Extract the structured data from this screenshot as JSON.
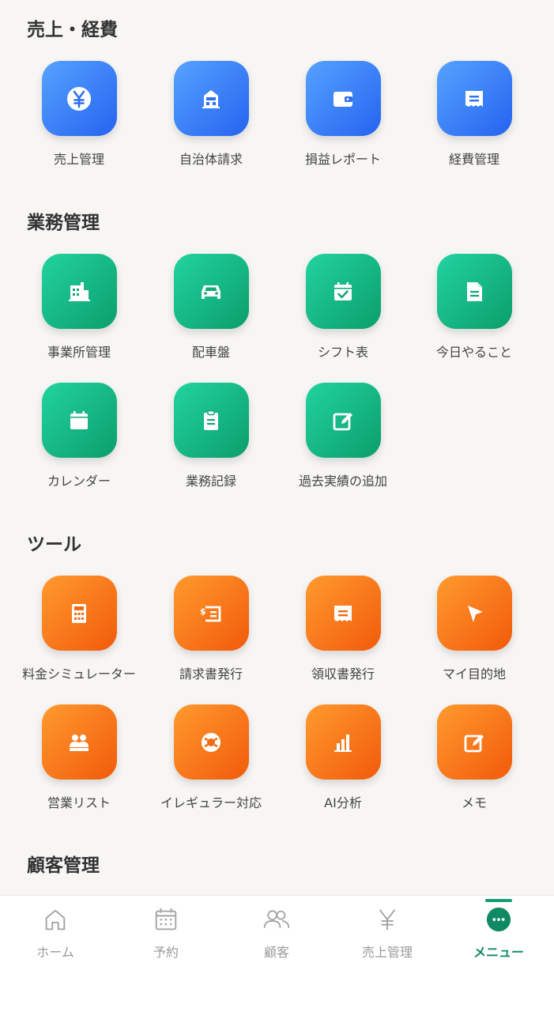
{
  "sections": {
    "sales": {
      "title": "売上・経費",
      "items": [
        "売上管理",
        "自治体請求",
        "損益レポート",
        "経費管理"
      ]
    },
    "operations": {
      "title": "業務管理",
      "items": [
        "事業所管理",
        "配車盤",
        "シフト表",
        "今日やること",
        "カレンダー",
        "業務記録",
        "過去実績の追加"
      ]
    },
    "tools": {
      "title": "ツール",
      "items": [
        "料金シミュレーター",
        "請求書発行",
        "領収書発行",
        "マイ目的地",
        "営業リスト",
        "イレギュラー対応",
        "AI分析",
        "メモ"
      ]
    },
    "customers": {
      "title": "顧客管理"
    }
  },
  "nav": {
    "items": [
      "ホーム",
      "予約",
      "顧客",
      "売上管理",
      "メニュー"
    ],
    "active": "メニュー"
  },
  "colors": {
    "blue": "#2f7cf6",
    "green": "#12b886",
    "orange": "#fb7a17",
    "active_nav": "#0f8a63"
  }
}
